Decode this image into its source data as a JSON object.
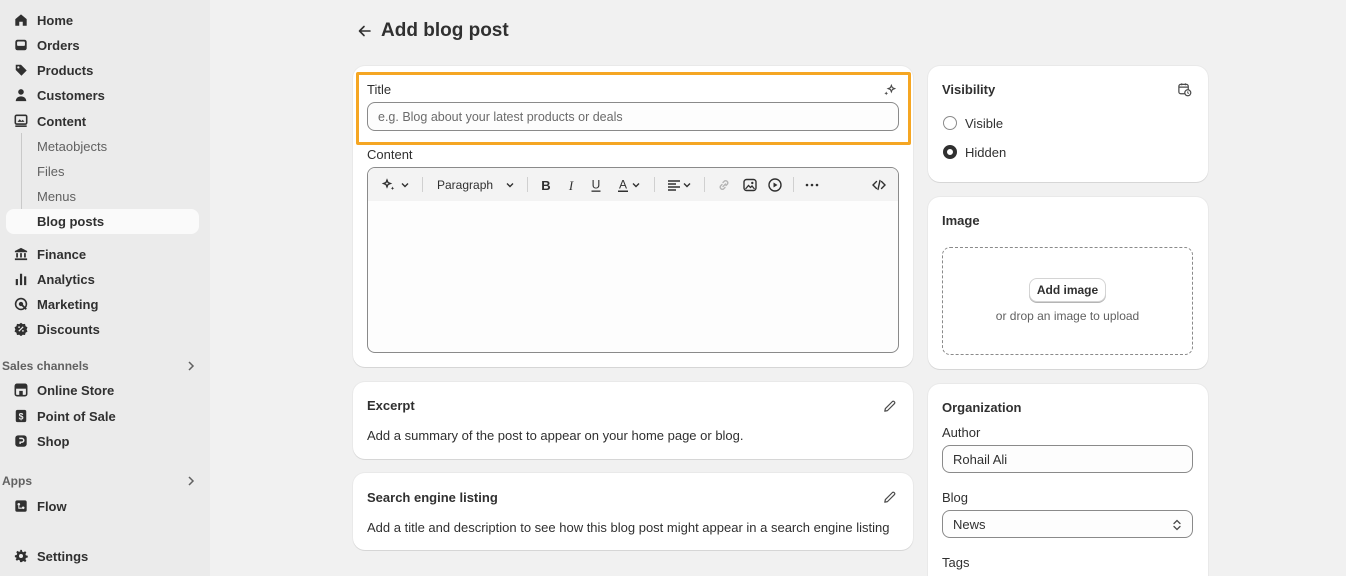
{
  "sidebar": {
    "home": "Home",
    "orders": "Orders",
    "products": "Products",
    "customers": "Customers",
    "content": "Content",
    "content_sub": [
      "Metaobjects",
      "Files",
      "Menus",
      "Blog posts"
    ],
    "finance": "Finance",
    "analytics": "Analytics",
    "marketing": "Marketing",
    "discounts": "Discounts",
    "sales_channels_label": "Sales channels",
    "online_store": "Online Store",
    "point_of_sale": "Point of Sale",
    "shop": "Shop",
    "apps_label": "Apps",
    "flow": "Flow",
    "settings": "Settings"
  },
  "header": {
    "title": "Add blog post"
  },
  "main": {
    "title_label": "Title",
    "title_placeholder": "e.g. Blog about your latest products or deals",
    "content_label": "Content",
    "toolbar": {
      "paragraph": "Paragraph"
    },
    "excerpt": {
      "title": "Excerpt",
      "text": "Add a summary of the post to appear on your home page or blog."
    },
    "seo": {
      "title": "Search engine listing",
      "text": "Add a title and description to see how this blog post might appear in a search engine listing"
    }
  },
  "visibility": {
    "title": "Visibility",
    "options": [
      "Visible",
      "Hidden"
    ],
    "selected": "Hidden"
  },
  "image": {
    "title": "Image",
    "button": "Add image",
    "drop_text": "or drop an image to upload"
  },
  "organization": {
    "title": "Organization",
    "author_label": "Author",
    "author_value": "Rohail Ali",
    "blog_label": "Blog",
    "blog_value": "News",
    "tags_label": "Tags"
  },
  "colors": {
    "highlight": "#f5a623",
    "sidebar_bg": "#ebebeb",
    "page_bg": "#f1f1f1"
  }
}
